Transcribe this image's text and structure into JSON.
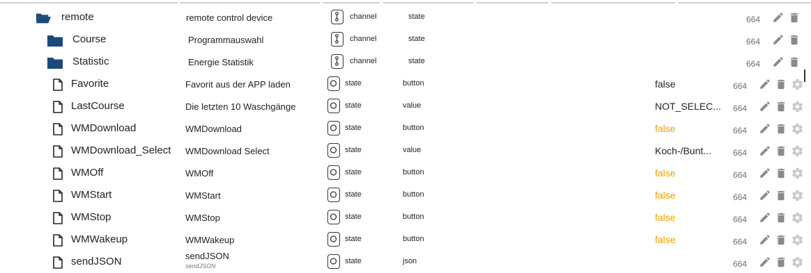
{
  "colors": {
    "folder": "#1a4a7a",
    "false_value": "#f0a000",
    "action_icon": "#8a8a8a"
  },
  "rows": [
    {
      "kind": "folder",
      "icon": "folder-open-icon",
      "name": "remote",
      "desc": "remote control device",
      "desc_sub": "",
      "type": "channel",
      "role": "state",
      "value": "",
      "value_color": "",
      "acl": "664",
      "actions": [
        "edit",
        "delete"
      ]
    },
    {
      "kind": "folder",
      "icon": "folder-icon",
      "name": "Course",
      "desc": "Programmauswahl",
      "desc_sub": "",
      "type": "channel",
      "role": "state",
      "value": "",
      "value_color": "",
      "acl": "664",
      "actions": [
        "edit",
        "delete"
      ]
    },
    {
      "kind": "folder",
      "icon": "folder-icon",
      "name": "Statistic",
      "desc": "Energie Statistik",
      "desc_sub": "",
      "type": "channel",
      "role": "state",
      "value": "",
      "value_color": "",
      "acl": "664",
      "actions": [
        "edit",
        "delete"
      ]
    },
    {
      "kind": "state",
      "icon": "file-icon",
      "name": "Favorite",
      "desc": "Favorit aus der APP laden",
      "desc_sub": "",
      "type": "state",
      "role": "button",
      "value": "false",
      "value_color": "normal",
      "acl": "664",
      "actions": [
        "edit",
        "delete",
        "settings"
      ]
    },
    {
      "kind": "state",
      "icon": "file-icon",
      "name": "LastCourse",
      "desc": "Die letzten 10 Waschgänge",
      "desc_sub": "",
      "type": "state",
      "role": "value",
      "value": "NOT_SELEC...",
      "value_color": "normal",
      "acl": "664",
      "actions": [
        "edit",
        "delete",
        "settings"
      ]
    },
    {
      "kind": "state",
      "icon": "file-icon",
      "name": "WMDownload",
      "desc": "WMDownload",
      "desc_sub": "",
      "type": "state",
      "role": "button",
      "value": "false",
      "value_color": "false",
      "acl": "664",
      "actions": [
        "edit",
        "delete",
        "settings"
      ]
    },
    {
      "kind": "state",
      "icon": "file-icon",
      "name": "WMDownload_Select",
      "desc": "WMDownload Select",
      "desc_sub": "",
      "type": "state",
      "role": "value",
      "value": "Koch-/Bunt...",
      "value_color": "normal",
      "acl": "664",
      "actions": [
        "edit",
        "delete",
        "settings"
      ]
    },
    {
      "kind": "state",
      "icon": "file-icon",
      "name": "WMOff",
      "desc": "WMOff",
      "desc_sub": "",
      "type": "state",
      "role": "button",
      "value": "false",
      "value_color": "false",
      "acl": "664",
      "actions": [
        "edit",
        "delete",
        "settings"
      ]
    },
    {
      "kind": "state",
      "icon": "file-icon",
      "name": "WMStart",
      "desc": "WMStart",
      "desc_sub": "",
      "type": "state",
      "role": "button",
      "value": "false",
      "value_color": "false",
      "acl": "664",
      "actions": [
        "edit",
        "delete",
        "settings"
      ]
    },
    {
      "kind": "state",
      "icon": "file-icon",
      "name": "WMStop",
      "desc": "WMStop",
      "desc_sub": "",
      "type": "state",
      "role": "button",
      "value": "false",
      "value_color": "false",
      "acl": "664",
      "actions": [
        "edit",
        "delete",
        "settings"
      ]
    },
    {
      "kind": "state",
      "icon": "file-icon",
      "name": "WMWakeup",
      "desc": "WMWakeup",
      "desc_sub": "",
      "type": "state",
      "role": "button",
      "value": "false",
      "value_color": "false",
      "acl": "664",
      "actions": [
        "edit",
        "delete",
        "settings"
      ]
    },
    {
      "kind": "state",
      "icon": "file-icon",
      "name": "sendJSON",
      "desc": "sendJSON",
      "desc_sub": "sendJSON",
      "type": "state",
      "role": "json",
      "value": "",
      "value_color": "normal",
      "acl": "664",
      "actions": [
        "edit",
        "delete",
        "settings"
      ]
    }
  ]
}
